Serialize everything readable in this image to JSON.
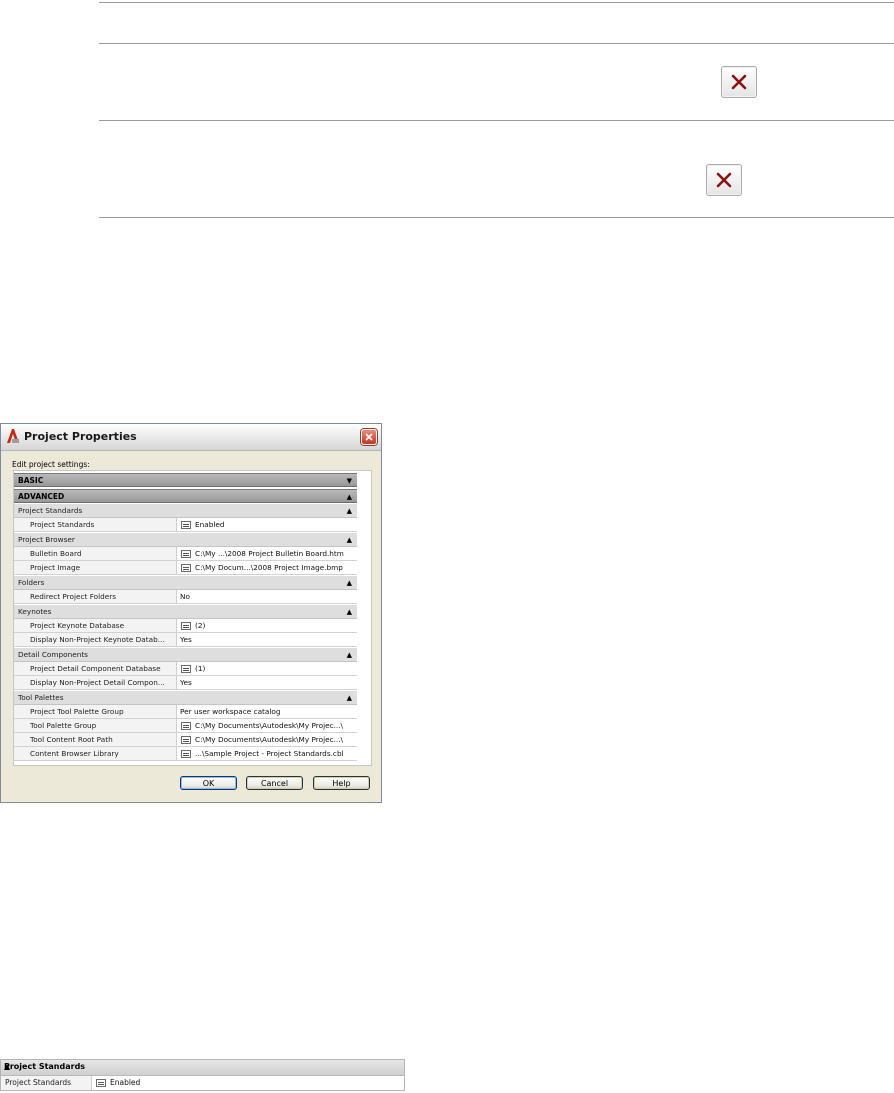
{
  "dialog": {
    "title": "Project Properties",
    "caption": "Edit project settings:",
    "sections": {
      "basic": "BASIC",
      "advanced": "ADVANCED"
    },
    "categories": {
      "project_standards": "Project Standards",
      "project_browser": "Project Browser",
      "folders": "Folders",
      "keynotes": "Keynotes",
      "detail_components": "Detail Components",
      "tool_palettes": "Tool Palettes"
    },
    "properties": [
      {
        "name": "Project Standards",
        "value": "Enabled"
      },
      {
        "name": "Bulletin Board",
        "value": "C:\\My ...\\2008 Project Bulletin Board.htm"
      },
      {
        "name": "Project Image",
        "value": "C:\\My Docum...\\2008 Project Image.bmp"
      },
      {
        "name": "Redirect Project Folders",
        "value": "No"
      },
      {
        "name": "Project Keynote Database",
        "value": "(2)"
      },
      {
        "name": "Display Non-Project Keynote Datab...",
        "value": "Yes"
      },
      {
        "name": "Project Detail Component Database",
        "value": "(1)"
      },
      {
        "name": "Display Non-Project Detail Compon...",
        "value": "Yes"
      },
      {
        "name": "Project Tool Palette Group",
        "value": "Per user workspace catalog"
      },
      {
        "name": "Tool Palette Group",
        "value": "C:\\My Documents\\Autodesk\\My Projec...\\"
      },
      {
        "name": "Tool Content Root Path",
        "value": "C:\\My Documents\\Autodesk\\My Projec...\\"
      },
      {
        "name": "Content Browser Library",
        "value": "...\\Sample Project - Project Standards.cbl"
      }
    ],
    "buttons": {
      "ok": "OK",
      "cancel": "Cancel",
      "help": "Help"
    },
    "arrows": {
      "collapsed": "▼",
      "expanded": "▲"
    }
  },
  "snippet": {
    "header": "Project Standards",
    "name": "Project Standards",
    "value": "Enabled"
  },
  "colors": {
    "delete_x": "#8b1212",
    "close_button": "#c23a24"
  }
}
